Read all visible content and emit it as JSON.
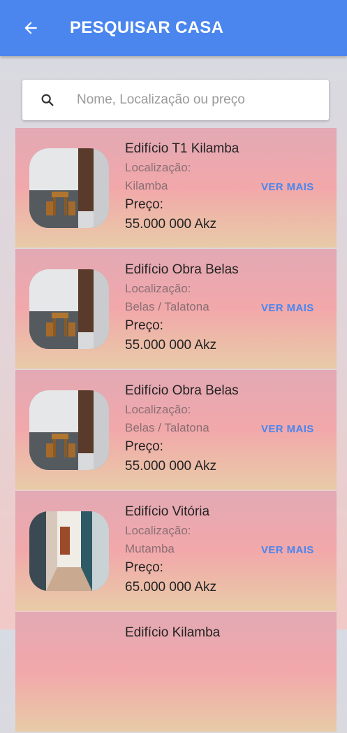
{
  "appbar": {
    "title": "PESQUISAR CASA",
    "back_icon": "arrow-left-icon",
    "color": "#4a86ee"
  },
  "search": {
    "placeholder": "Nome, Localização ou preço",
    "value": "",
    "icon": "search-icon"
  },
  "listings": [
    {
      "name": "Edifício T1 Kilamba",
      "location_label": "Localização:",
      "location": "Kilamba",
      "price_label": "Preço:",
      "price": "55.000 000 Akz",
      "action": "VER MAIS"
    },
    {
      "name": "Edifício Obra Belas",
      "location_label": "Localização:",
      "location": "Belas / Talatona",
      "price_label": "Preço:",
      "price": "55.000 000 Akz",
      "action": "VER MAIS"
    },
    {
      "name": "Edifício Obra Belas",
      "location_label": "Localização:",
      "location": "Belas / Talatona",
      "price_label": "Preço:",
      "price": "55.000 000 Akz",
      "action": "VER MAIS"
    },
    {
      "name": "Edifício Vitória",
      "location_label": "Localização:",
      "location": "Mutamba",
      "price_label": "Preço:",
      "price": "65.000 000 Akz",
      "action": "VER MAIS"
    },
    {
      "name": "Edifício Kilamba",
      "location_label": "",
      "location": "",
      "price_label": "",
      "price": "",
      "action": ""
    }
  ]
}
